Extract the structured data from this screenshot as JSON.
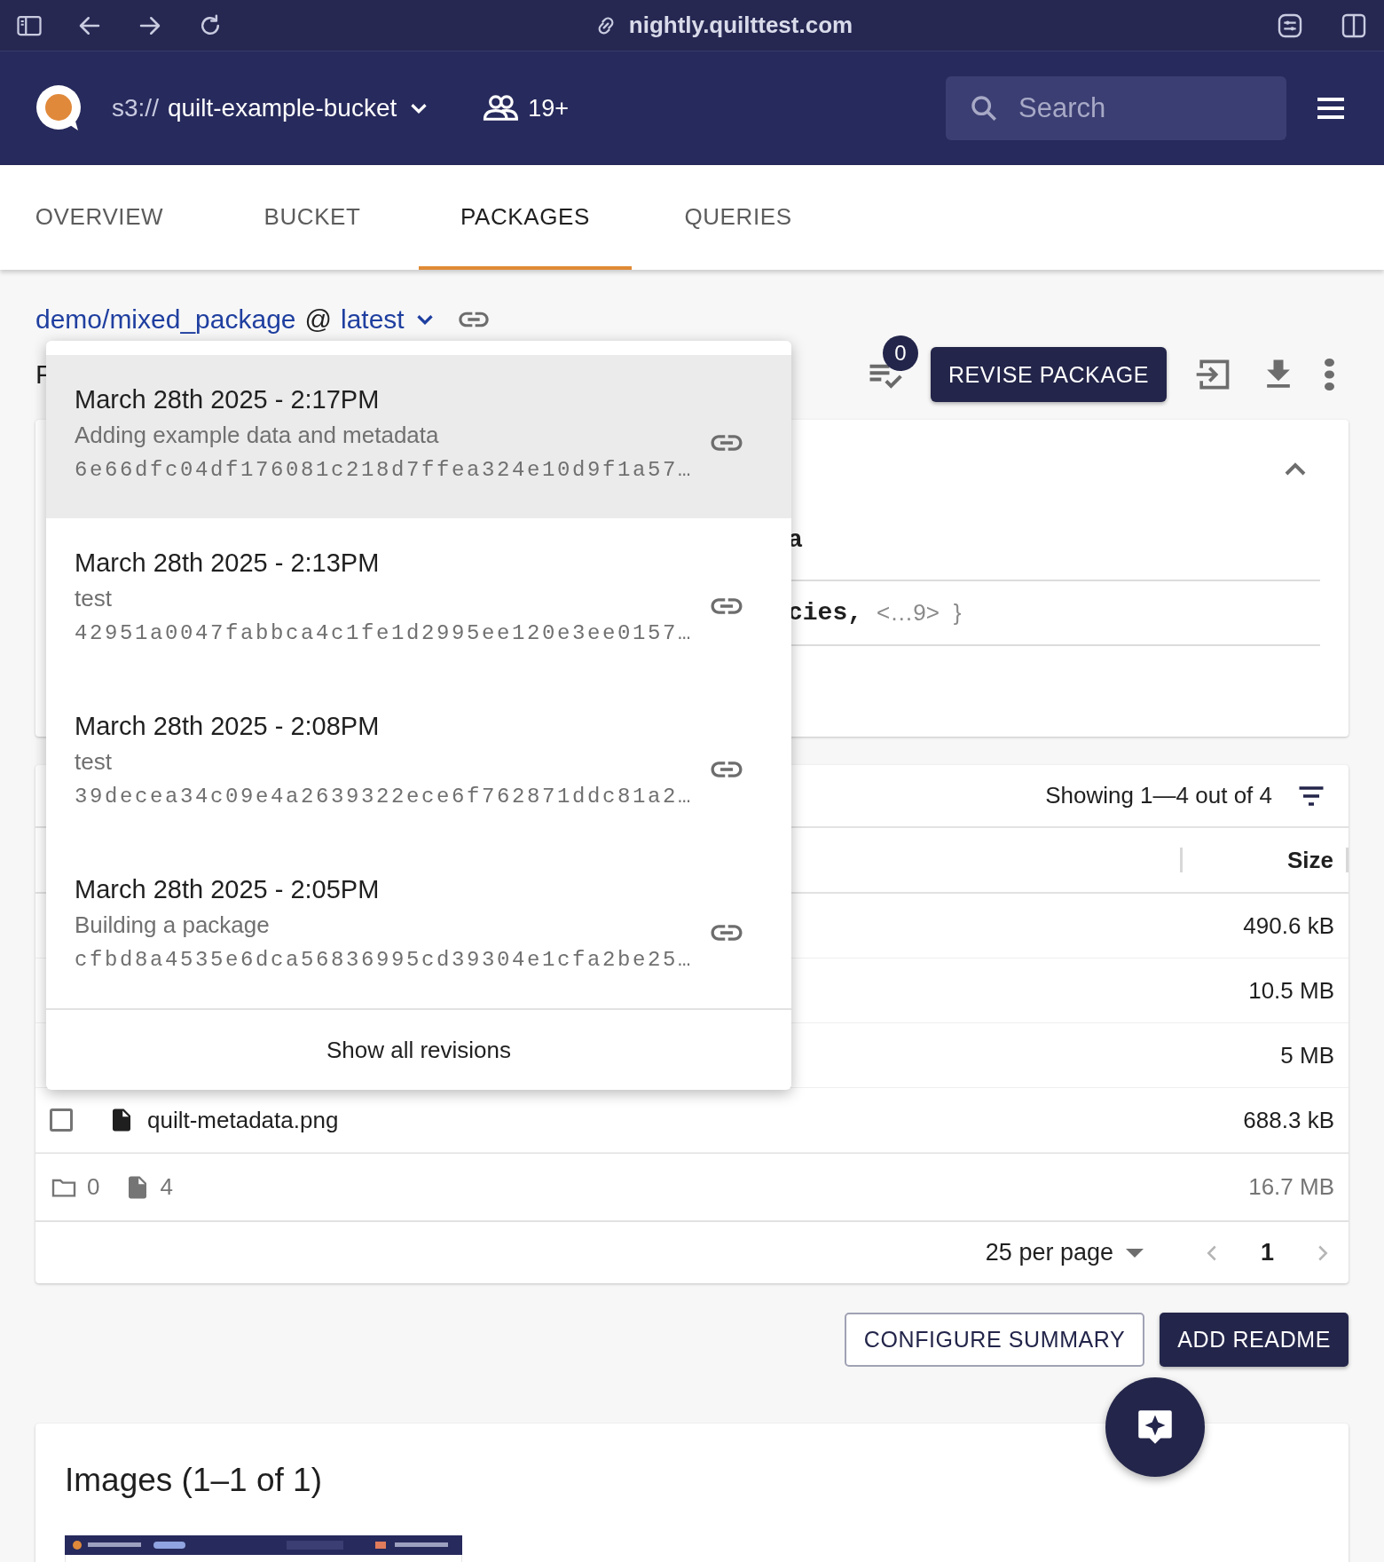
{
  "browser": {
    "url": "nightly.quilttest.com"
  },
  "header": {
    "bucket_prefix": "s3://",
    "bucket_name": "quilt-example-bucket",
    "collaborators": "19+",
    "search": {
      "placeholder": "Search"
    }
  },
  "tabs": [
    {
      "label": "OVERVIEW",
      "selected": false
    },
    {
      "label": "BUCKET",
      "selected": false
    },
    {
      "label": "PACKAGES",
      "selected": true
    },
    {
      "label": "QUERIES",
      "selected": false
    }
  ],
  "package": {
    "name": "demo/mixed_package",
    "separator": "@",
    "revision": "latest"
  },
  "heading_visible_part": "F",
  "toolbar": {
    "selection_count": "0",
    "revise_button": "REVISE PACKAGE"
  },
  "metadata": {
    "expanded": true,
    "rows": [
      {
        "key": "a"
      },
      {
        "key": "cies,",
        "collapsed": "<…9>",
        "close": "}"
      }
    ]
  },
  "files": {
    "summary": "Showing 1—4 out of 4",
    "size_column": "Size",
    "rows": [
      {
        "size": "490.6 kB"
      },
      {
        "size": "10.5 MB"
      },
      {
        "size": "5 MB"
      },
      {
        "name": "quilt-metadata.png",
        "size": "688.3 kB",
        "checked": false
      }
    ],
    "totals": {
      "folders": "0",
      "files": "4",
      "size": "16.7 MB"
    },
    "per_page": "25 per page",
    "page": "1"
  },
  "actions": [
    {
      "label": "CONFIGURE SUMMARY",
      "kind": "outlined"
    },
    {
      "label": "ADD README",
      "kind": "filled"
    }
  ],
  "images": {
    "title": "Images (1–1 of 1)"
  },
  "revisions": {
    "items": [
      {
        "date": "March 28th 2025 - 2:17PM",
        "message": "Adding example data and metadata",
        "hash": "6e66dfc04df176081c218d7ffea324e10d9f1a57…",
        "selected": true
      },
      {
        "date": "March 28th 2025 - 2:13PM",
        "message": "test",
        "hash": "42951a0047fabbca4c1fe1d2995ee120e3ee0157…",
        "selected": false
      },
      {
        "date": "March 28th 2025 - 2:08PM",
        "message": "test",
        "hash": "39decea34c09e4a2639322ece6f762871ddc81a2…",
        "selected": false
      },
      {
        "date": "March 28th 2025 - 2:05PM",
        "message": "Building a package",
        "hash": "cfbd8a4535e6dca56836995cd39304e1cfa2be25…",
        "selected": false
      }
    ],
    "show_all": "Show all revisions"
  }
}
